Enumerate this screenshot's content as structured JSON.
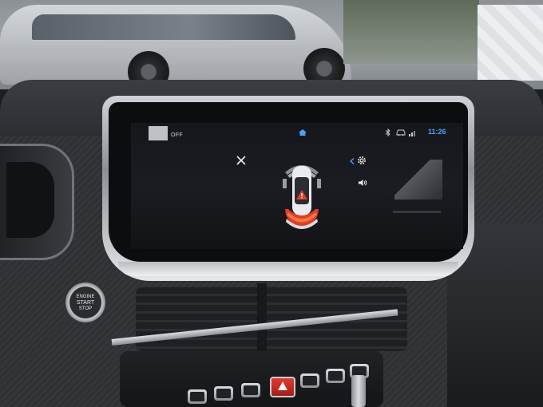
{
  "screen": {
    "status": {
      "off_label": "OFF",
      "clock": "11:26"
    },
    "icons": {
      "close": "close-icon",
      "home": "home-icon",
      "bluetooth": "bluetooth-icon",
      "car_status": "car-icon",
      "signal": "signal-icon",
      "settings": "gear-icon",
      "back": "chevron-left-icon",
      "volume": "volume-icon",
      "warning": "warning-triangle-icon"
    },
    "accent_color": "#4aa3ff",
    "warning_color": "#e53b2b"
  },
  "console": {
    "start_button": {
      "line1": "ENGINE",
      "line2": "START",
      "line3": "STOP"
    }
  }
}
